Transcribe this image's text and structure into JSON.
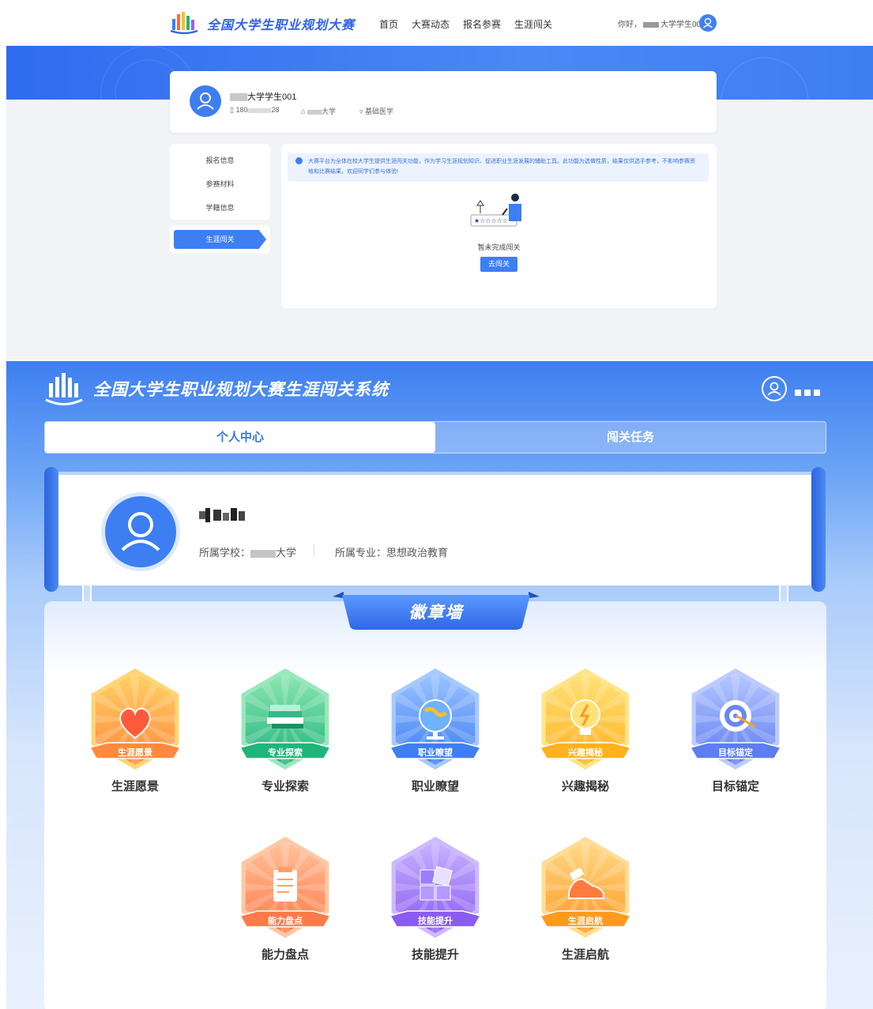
{
  "site": {
    "brand": "全国大学生职业规划大赛",
    "nav": [
      "首页",
      "大赛动态",
      "报名参赛",
      "生涯闯关"
    ],
    "greeting_prefix": "你好，",
    "greeting_suffix": "大学学生001"
  },
  "profile": {
    "name_suffix": "大学学生001",
    "phone_prefix": "180",
    "phone_suffix": "28",
    "school_suffix": "大学",
    "major": "基础医学"
  },
  "sidebar": {
    "items": [
      "报名信息",
      "参赛材料",
      "学籍信息"
    ],
    "active": "生涯闯关"
  },
  "notice": "大赛平台为全体在校大学生提供生涯闯关功能，作为学习生涯规划知识、促进职业生涯发展的辅助工具。此功能为选做性质，结果仅供选手参考，不影响参赛资格和比赛结果，欢迎同学们参与体验!",
  "empty_state": {
    "message": "暂未完成闯关",
    "button": "去闯关"
  },
  "system": {
    "title": "全国大学生职业规划大赛生涯闯关系统",
    "tabs": [
      "个人中心",
      "闯关任务"
    ],
    "school_label": "所属学校：",
    "school_suffix": "大学",
    "major_label": "所属专业：",
    "major": "思想政治教育",
    "wall_title": "徽章墙"
  },
  "badges": [
    {
      "label": "生涯愿景",
      "emblem": "生涯愿景",
      "icon": "heart-icon",
      "color": "#ff8a3d",
      "color2": "#ffd166"
    },
    {
      "label": "专业探索",
      "emblem": "专业探索",
      "icon": "book-icon",
      "color": "#1fb57a",
      "color2": "#8ee6b4"
    },
    {
      "label": "职业瞭望",
      "emblem": "职业瞭望",
      "icon": "globe-icon",
      "color": "#3d7ef2",
      "color2": "#9cc4ff"
    },
    {
      "label": "兴趣揭秘",
      "emblem": "兴趣揭秘",
      "icon": "lightbulb-icon",
      "color": "#ffb21f",
      "color2": "#ffe27a"
    },
    {
      "label": "目标锚定",
      "emblem": "目标锚定",
      "icon": "target-icon",
      "color": "#5d7df0",
      "color2": "#b6c7ff"
    },
    {
      "label": "能力盘点",
      "emblem": "能力盘点",
      "icon": "clipboard-icon",
      "color": "#ff7b4a",
      "color2": "#ffc29a"
    },
    {
      "label": "技能提升",
      "emblem": "技能提升",
      "icon": "blocks-icon",
      "color": "#8a5cf0",
      "color2": "#c8b2ff"
    },
    {
      "label": "生涯启航",
      "emblem": "生涯启航",
      "icon": "sneaker-icon",
      "color": "#ff9a1f",
      "color2": "#ffd98a"
    }
  ]
}
